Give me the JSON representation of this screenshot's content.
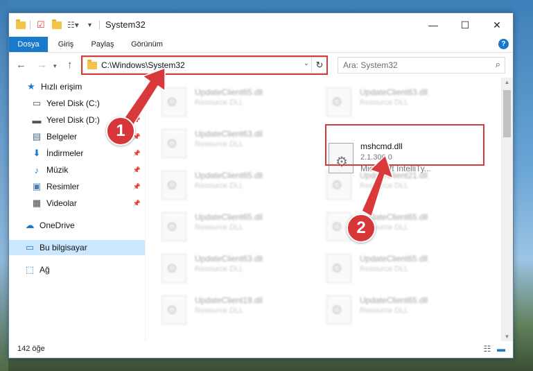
{
  "window": {
    "title": "System32",
    "controls": {
      "minimize": "—",
      "maximize": "☐",
      "close": "✕"
    }
  },
  "ribbon": {
    "tabs": [
      {
        "label": "Dosya"
      },
      {
        "label": "Giriş"
      },
      {
        "label": "Paylaş"
      },
      {
        "label": "Görünüm"
      }
    ],
    "help": "?"
  },
  "address": {
    "path": "C:\\Windows\\System32",
    "search_placeholder": "Ara: System32"
  },
  "nav": {
    "items": [
      {
        "label": "Hızlı erişim",
        "icon": "star-icon"
      },
      {
        "label": "Yerel Disk (C:)",
        "icon": "drive-icon"
      },
      {
        "label": "Yerel Disk (D:)",
        "icon": "drive-icon"
      },
      {
        "label": "Belgeler",
        "icon": "documents-icon"
      },
      {
        "label": "İndirmeler",
        "icon": "download-icon"
      },
      {
        "label": "Müzik",
        "icon": "music-icon"
      },
      {
        "label": "Resimler",
        "icon": "pictures-icon"
      },
      {
        "label": "Videolar",
        "icon": "video-icon"
      },
      {
        "label": "OneDrive",
        "icon": "cloud-icon"
      },
      {
        "label": "Bu bilgisayar",
        "icon": "computer-icon"
      },
      {
        "label": "Ağ",
        "icon": "network-icon"
      }
    ]
  },
  "files": {
    "blurred_left": [
      {
        "name": "UpdateClient65.dll",
        "desc": "Resource DLL"
      },
      {
        "name": "UpdateClient63.dll",
        "desc": "Resource DLL"
      },
      {
        "name": "UpdateClient65.dll",
        "desc": "Resource DLL"
      },
      {
        "name": "UpdateClient65.dll",
        "desc": "Resource DLL"
      },
      {
        "name": "UpdateClient63.dll",
        "desc": "Resource DLL"
      },
      {
        "name": "UpdateClient19.dll",
        "desc": "Resource DLL"
      }
    ],
    "blurred_right": [
      {
        "name": "UpdateClient63.dll",
        "desc": "Resource DLL"
      },
      {
        "name": "UpdateClient21.dll",
        "desc": "Resource DLL"
      },
      {
        "name": "UpdateClient65.dll",
        "desc": "Resource DLL"
      },
      {
        "name": "UpdateClient65.dll",
        "desc": "Resource DLL"
      },
      {
        "name": "UpdateClient65.dll",
        "desc": "Resource DLL"
      }
    ],
    "target": {
      "name": "mshcmd.dll",
      "version": "2.1.300.0",
      "company": "Microsoft IntelliTy..."
    }
  },
  "status": {
    "count": "142 öğe"
  },
  "callouts": {
    "step1": "1",
    "step2": "2"
  },
  "colors": {
    "accent": "#1979ca",
    "highlight": "#d9393b",
    "selected": "#cce8ff"
  }
}
